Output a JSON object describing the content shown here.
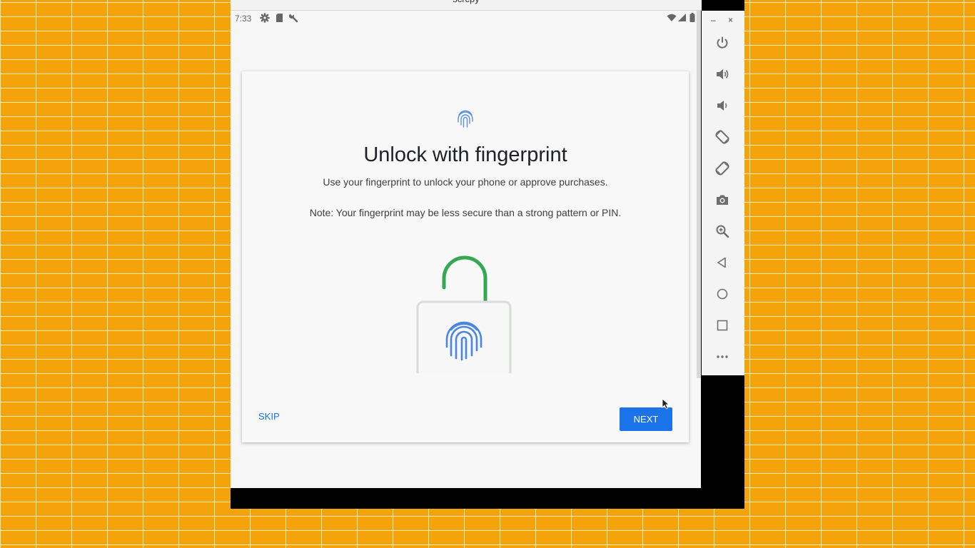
{
  "window": {
    "title": "scrcpy"
  },
  "statusbar": {
    "time": "7:33",
    "left_icons": [
      "gear-icon",
      "sd-card-icon",
      "wrench-icon"
    ],
    "right_icons": [
      "wifi-icon",
      "signal-icon",
      "battery-icon"
    ]
  },
  "setup": {
    "header_icon": "fingerprint-icon",
    "title": "Unlock with fingerprint",
    "description": "Use your fingerprint to unlock your phone or approve purchases.",
    "note": "Note: Your fingerprint may be less secure than a strong pattern or PIN.",
    "illustration": "unlocked-padlock-fingerprint",
    "skip_label": "SKIP",
    "next_label": "NEXT"
  },
  "toolbar": {
    "minimize_label": "–",
    "close_label": "×",
    "buttons": [
      "power",
      "volume-up",
      "volume-down",
      "rotate-left",
      "rotate-right",
      "screenshot",
      "zoom",
      "back",
      "home",
      "overview",
      "more"
    ]
  },
  "colors": {
    "accent": "#1a73e8",
    "lock_shackle": "#34a853",
    "desktop_bg": "#f5a30b"
  }
}
